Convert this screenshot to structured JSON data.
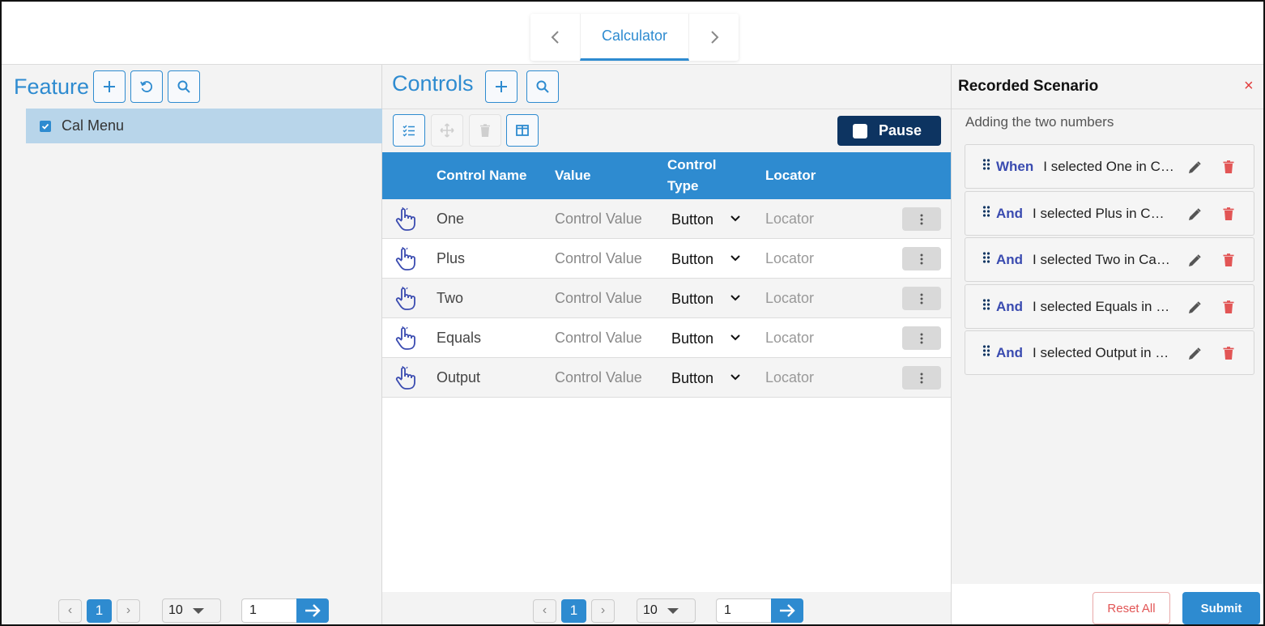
{
  "tabs": {
    "active": "Calculator"
  },
  "feature": {
    "title": "Feature",
    "tree_items": [
      {
        "label": "Cal Menu",
        "checked": true
      }
    ],
    "pager": {
      "page": "1",
      "page_size": "10",
      "goto": "1"
    }
  },
  "controls": {
    "title": "Controls",
    "pause_label": "Pause",
    "columns": {
      "name": "Control Name",
      "value": "Value",
      "type": "Control Type",
      "locator": "Locator"
    },
    "rows": [
      {
        "name": "One",
        "value": "Control Value",
        "type": "Button",
        "locator": "Locator"
      },
      {
        "name": "Plus",
        "value": "Control Value",
        "type": "Button",
        "locator": "Locator"
      },
      {
        "name": "Two",
        "value": "Control Value",
        "type": "Button",
        "locator": "Locator"
      },
      {
        "name": "Equals",
        "value": "Control Value",
        "type": "Button",
        "locator": "Locator"
      },
      {
        "name": "Output",
        "value": "Control Value",
        "type": "Button",
        "locator": "Locator"
      }
    ],
    "pager": {
      "page": "1",
      "page_size": "10",
      "goto": "1"
    }
  },
  "scenario": {
    "title": "Recorded Scenario",
    "close": "×",
    "description": "Adding the two numbers",
    "steps": [
      {
        "keyword": "When",
        "text": "I selected One in Calculator"
      },
      {
        "keyword": "And",
        "text": "I selected Plus in Calculator"
      },
      {
        "keyword": "And",
        "text": "I selected Two in Calculator"
      },
      {
        "keyword": "And",
        "text": "I selected Equals in Calculator"
      },
      {
        "keyword": "And",
        "text": "I selected Output in Calculator"
      }
    ],
    "reset_label": "Reset All",
    "submit_label": "Submit"
  },
  "colors": {
    "accent": "#2e8bd0",
    "pause": "#0d3461",
    "keyword": "#3a4bb0",
    "danger": "#e25555",
    "selected_row": "#b8d5ea"
  }
}
